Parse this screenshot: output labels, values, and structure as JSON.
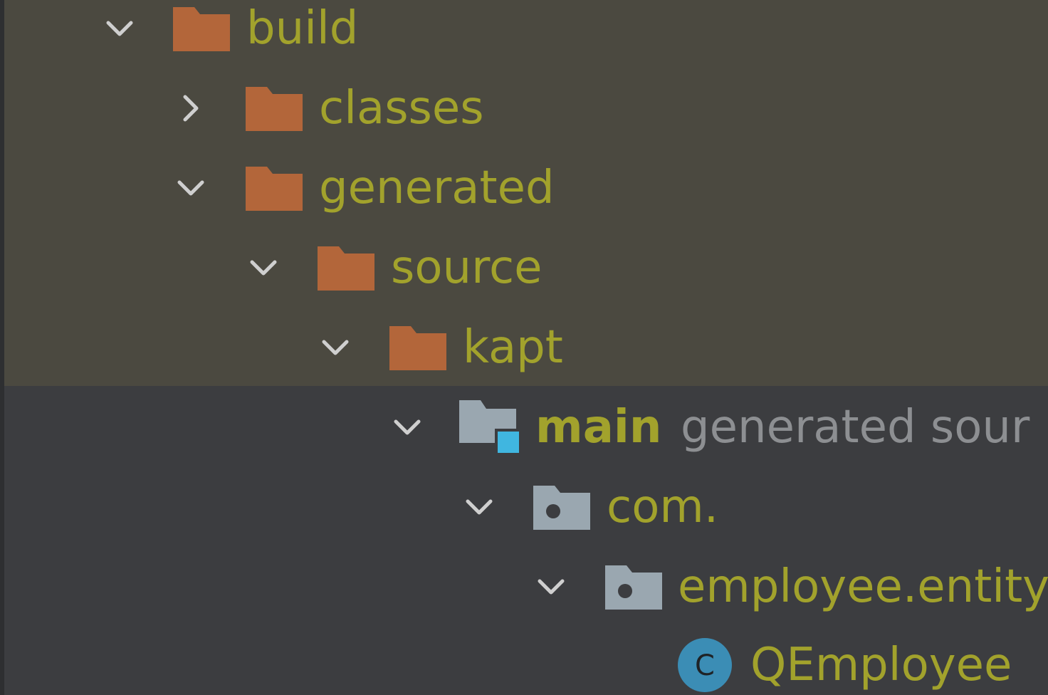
{
  "project_tree": {
    "nodes": [
      {
        "label": "build",
        "expanded": true,
        "icon": "excluded-folder-icon"
      },
      {
        "label": "classes",
        "expanded": false,
        "icon": "excluded-folder-icon"
      },
      {
        "label": "generated",
        "expanded": true,
        "icon": "excluded-folder-icon"
      },
      {
        "label": "source",
        "expanded": true,
        "icon": "excluded-folder-icon"
      },
      {
        "label": "kapt",
        "expanded": true,
        "icon": "excluded-folder-icon"
      },
      {
        "label": "main",
        "hint": "generated sour",
        "expanded": true,
        "icon": "generated-source-root-icon"
      },
      {
        "label": "com.",
        "expanded": true,
        "icon": "package-folder-icon"
      },
      {
        "label": "employee.entity",
        "expanded": true,
        "icon": "package-folder-icon"
      },
      {
        "label": "QEmployee",
        "icon": "java-class-icon",
        "icon_letter": "C"
      }
    ]
  },
  "colors": {
    "excluded_band": "#4b4940",
    "panel_background": "#3c3d40",
    "label_text": "#a2a22c",
    "hint_text": "#8d8f92",
    "excluded_folder": "#b3663a",
    "package_folder": "#9aa7b0",
    "source_root_badge": "#40b6e0",
    "class_icon": "#3b8db5",
    "chevron": "#cfcfcf"
  }
}
